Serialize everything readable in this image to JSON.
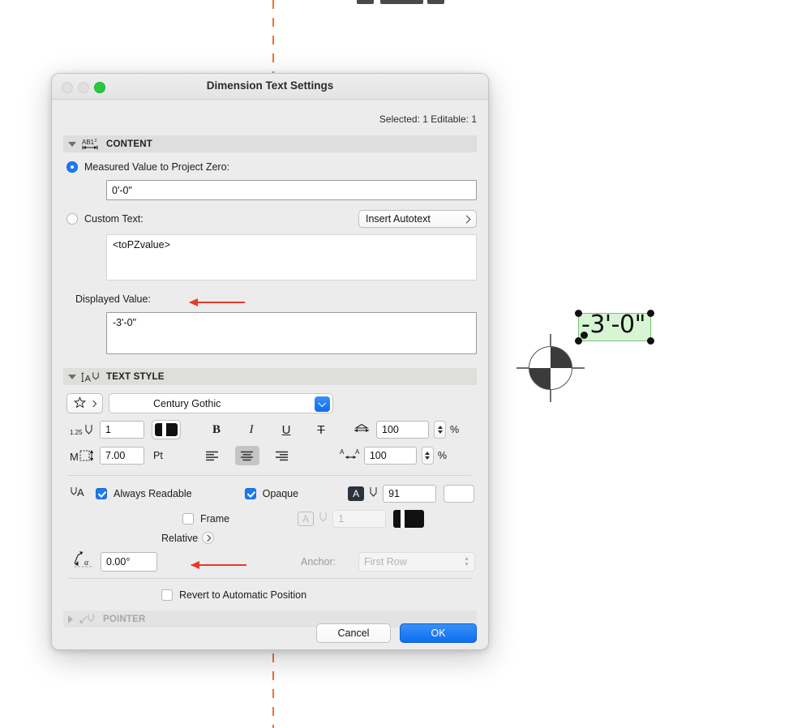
{
  "window": {
    "title": "Dimension Text Settings",
    "selected_status": "Selected: 1 Editable: 1"
  },
  "sections": {
    "content": {
      "title": "CONTENT",
      "icon": "ab1-dimension-icon",
      "measured_value_label": "Measured Value to Project Zero:",
      "measured_value": "0'-0\"",
      "custom_text_label": "Custom Text:",
      "insert_autotext_label": "Insert Autotext",
      "custom_text_value": "<toPZvalue>",
      "displayed_value_label": "Displayed Value:",
      "displayed_value": "-3'-0\""
    },
    "text_style": {
      "title": "TEXT STYLE",
      "icon": "text-style-icon",
      "favorites_icon": "star-icon",
      "font_name": "Century Gothic",
      "pen_label": "1.25",
      "pen_value": "1",
      "size_value": "7.00",
      "size_unit": "Pt",
      "bold_label": "B",
      "italic_label": "I",
      "underline_label": "U",
      "strikethrough_label": "T",
      "width_factor": "100",
      "width_unit": "%",
      "spacing_factor": "100",
      "spacing_unit": "%"
    },
    "options": {
      "always_readable_label": "Always Readable",
      "always_readable_checked": true,
      "opaque_label": "Opaque",
      "opaque_checked": true,
      "frame_label": "Frame",
      "frame_checked": false,
      "relative_label": "Relative",
      "angle_value": "0.00°",
      "anchor_label": "Anchor:",
      "anchor_value": "First Row",
      "background_pen": "91",
      "frame_pen": "1",
      "revert_label": "Revert to Automatic Position",
      "revert_checked": false
    },
    "pointer": {
      "title": "POINTER",
      "icon": "pointer-icon"
    }
  },
  "footer": {
    "cancel_label": "Cancel",
    "ok_label": "OK"
  },
  "canvas": {
    "dimension_text": "-3'-0\"",
    "marker_icon": "project-zero-marker-icon",
    "guide_color": "#f2712c",
    "selection_fill": "#d7f5d4",
    "selection_stroke": "#79c177"
  }
}
